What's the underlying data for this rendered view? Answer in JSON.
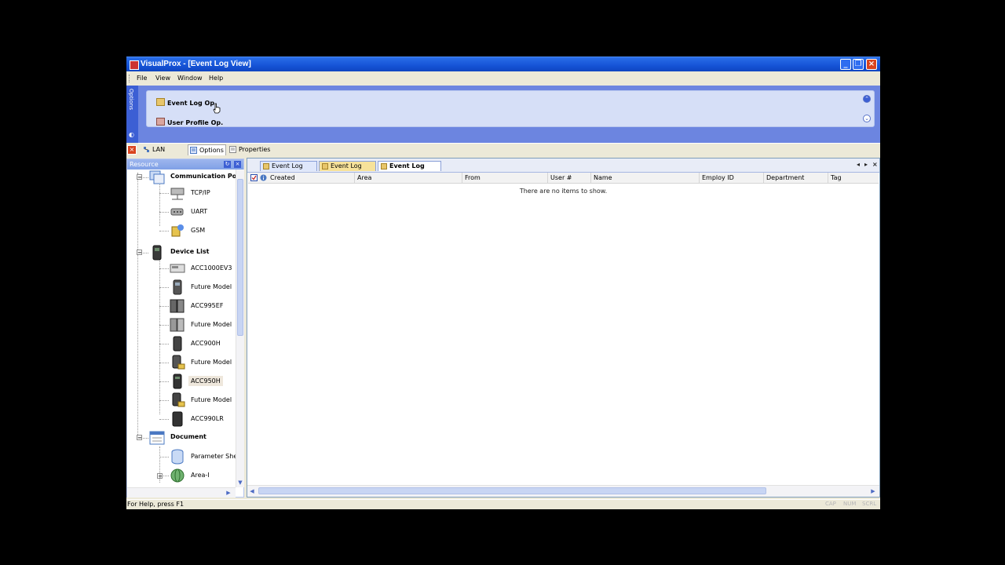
{
  "window": {
    "title": "VisualProx - [Event Log View]"
  },
  "menu": {
    "file": "File",
    "view": "View",
    "window": "Window",
    "help": "Help"
  },
  "options_panel": {
    "side_label": "Options",
    "items": [
      {
        "label": "Event Log Op."
      },
      {
        "label": "User Profile Op."
      }
    ]
  },
  "bottom_tabs": [
    {
      "label": "LAN Config"
    },
    {
      "label": "Options"
    },
    {
      "label": "Properties"
    }
  ],
  "resource": {
    "header": "Resource",
    "groups": [
      {
        "label": "Communication Port",
        "children": [
          "TCP/IP",
          "UART",
          "GSM"
        ]
      },
      {
        "label": "Device List",
        "children": [
          "ACC1000EV3",
          "Future Model",
          "ACC995EF",
          "Future Model",
          "ACC900H",
          "Future Model",
          "ACC950H",
          "Future Model",
          "ACC990LR"
        ]
      },
      {
        "label": "Document",
        "children": [
          "Parameter Sheet",
          "Area-I"
        ]
      }
    ]
  },
  "doc_tabs": [
    {
      "label": "Event Log View"
    },
    {
      "label": "Event Log View"
    },
    {
      "label": "Event Log View"
    }
  ],
  "columns": [
    "Created",
    "Area",
    "From",
    "User #",
    "Name",
    "Employ ID",
    "Department",
    "Tag"
  ],
  "list": {
    "empty_text": "There are no items to show."
  },
  "status": {
    "text": "For Help, press F1",
    "cap": "CAP",
    "num": "NUM",
    "scrl": "SCRL"
  }
}
